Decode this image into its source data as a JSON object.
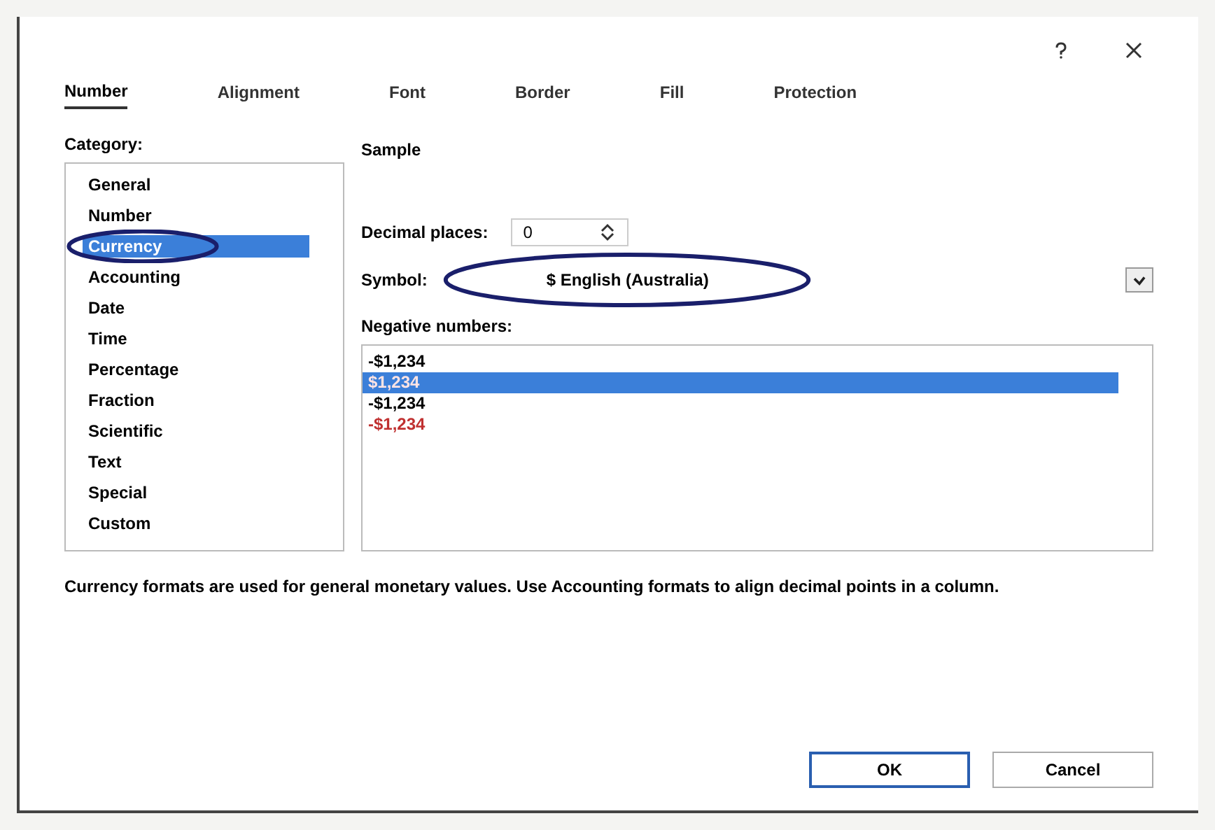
{
  "tabs": [
    {
      "label": "Number",
      "selected": true
    },
    {
      "label": "Alignment",
      "selected": false
    },
    {
      "label": "Font",
      "selected": false
    },
    {
      "label": "Border",
      "selected": false
    },
    {
      "label": "Fill",
      "selected": false
    },
    {
      "label": "Protection",
      "selected": false
    }
  ],
  "category": {
    "label": "Category:",
    "items": [
      {
        "label": "General",
        "selected": false
      },
      {
        "label": "Number",
        "selected": false
      },
      {
        "label": "Currency",
        "selected": true
      },
      {
        "label": "Accounting",
        "selected": false
      },
      {
        "label": "Date",
        "selected": false
      },
      {
        "label": "Time",
        "selected": false
      },
      {
        "label": "Percentage",
        "selected": false
      },
      {
        "label": "Fraction",
        "selected": false
      },
      {
        "label": "Scientific",
        "selected": false
      },
      {
        "label": "Text",
        "selected": false
      },
      {
        "label": "Special",
        "selected": false
      },
      {
        "label": "Custom",
        "selected": false
      }
    ]
  },
  "sample": {
    "label": "Sample"
  },
  "decimal_places": {
    "label": "Decimal places:",
    "value": "0"
  },
  "symbol": {
    "label": "Symbol:",
    "value": "$ English (Australia)"
  },
  "negative_numbers": {
    "label": "Negative numbers:",
    "items": [
      {
        "label": "-$1,234",
        "selected": false,
        "kind": "plain"
      },
      {
        "label": "$1,234",
        "selected": true,
        "kind": "red"
      },
      {
        "label": "-$1,234",
        "selected": false,
        "kind": "plain"
      },
      {
        "label": "-$1,234",
        "selected": false,
        "kind": "red"
      }
    ]
  },
  "description": "Currency formats are used for general monetary values.  Use Accounting formats to align decimal points in a column.",
  "buttons": [
    "OK",
    "Cancel"
  ]
}
